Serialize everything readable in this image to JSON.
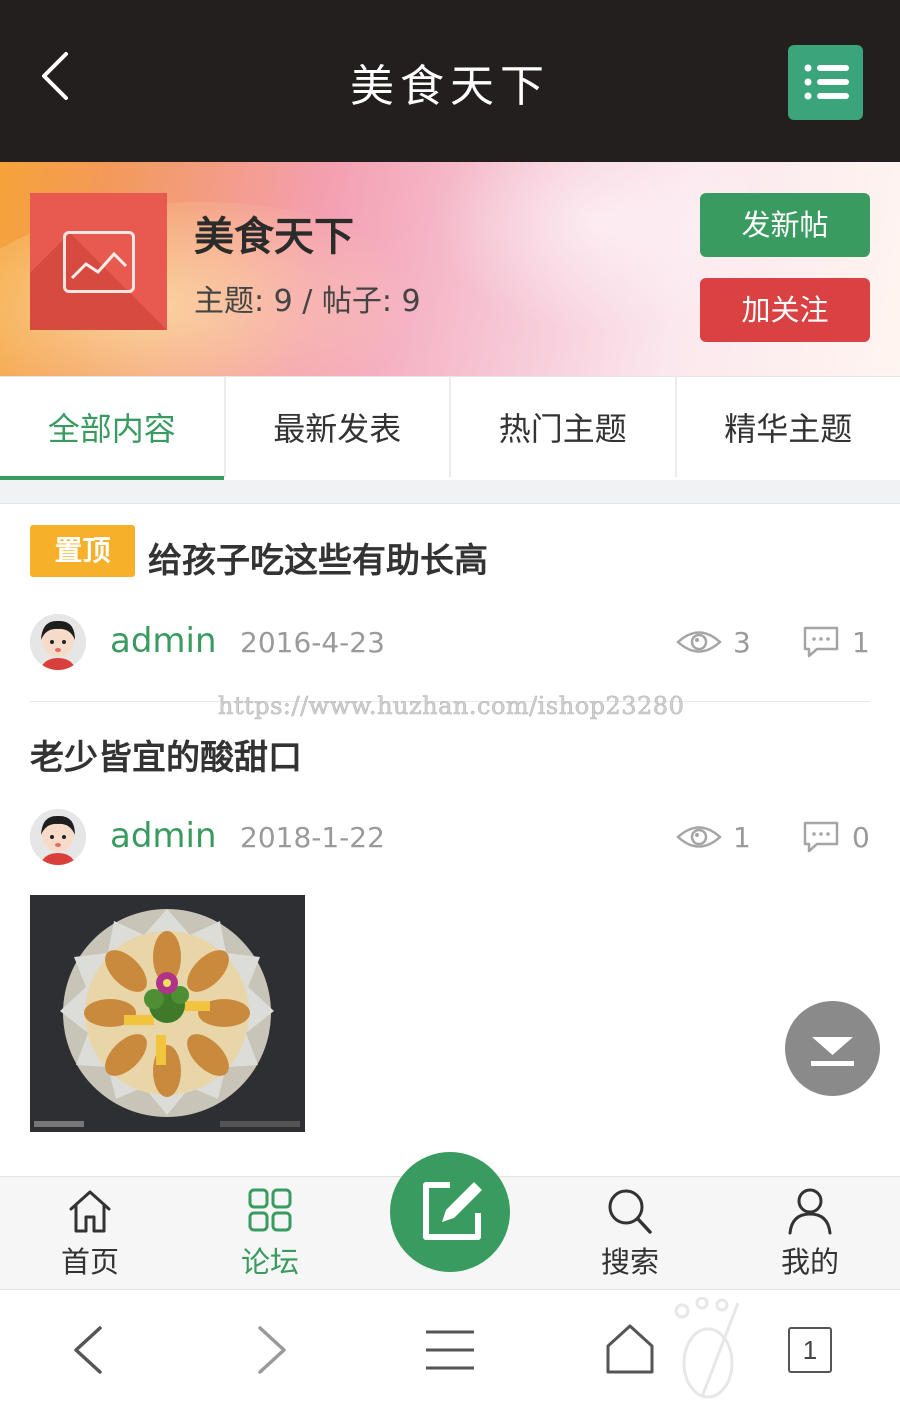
{
  "header": {
    "title": "美食天下"
  },
  "forum": {
    "name": "美食天下",
    "stats": "主题: 9 / 帖子: 9",
    "post_button": "发新帖",
    "follow_button": "加关注"
  },
  "tabs": [
    {
      "label": "全部内容",
      "active": true
    },
    {
      "label": "最新发表",
      "active": false
    },
    {
      "label": "热门主题",
      "active": false
    },
    {
      "label": "精华主题",
      "active": false
    }
  ],
  "posts": [
    {
      "badge": "置顶",
      "title": "给孩子吃这些有助长高",
      "author": "admin",
      "date": "2016-4-23",
      "views": "3",
      "replies": "1"
    },
    {
      "title": "老少皆宜的酸甜口",
      "author": "admin",
      "date": "2018-1-22",
      "views": "1",
      "replies": "0",
      "has_image": true
    }
  ],
  "watermark": "https://www.huzhan.com/ishop23280",
  "tabbar": [
    {
      "label": "首页",
      "icon": "home-icon",
      "active": false
    },
    {
      "label": "论坛",
      "icon": "grid-icon",
      "active": true
    },
    {
      "label": "搜索",
      "icon": "search-icon",
      "active": false
    },
    {
      "label": "我的",
      "icon": "user-icon",
      "active": false
    }
  ],
  "browser": {
    "tab_count": "1"
  },
  "colors": {
    "accent": "#3a9b60",
    "danger": "#d94143",
    "badge": "#f6b02a",
    "topbar": "#231f1e"
  }
}
